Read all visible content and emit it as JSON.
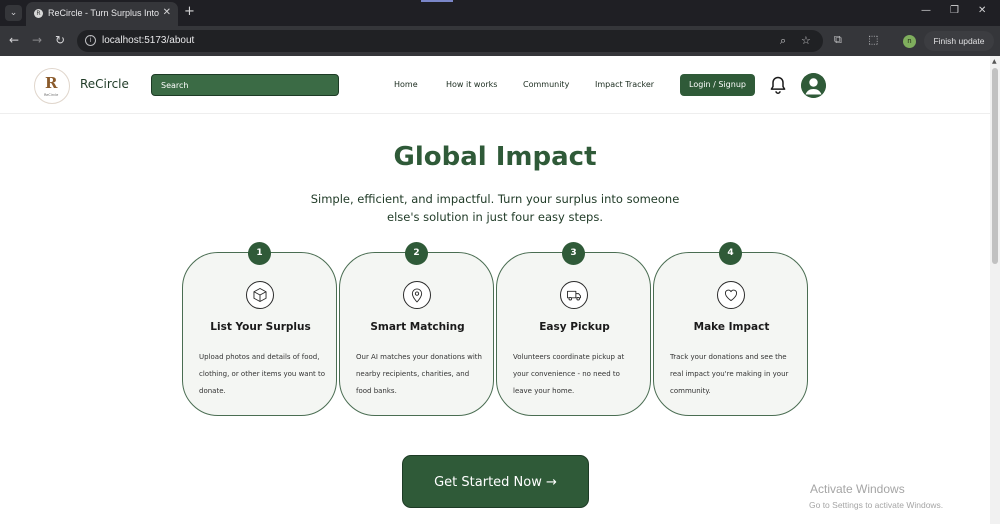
{
  "browser": {
    "tab_title": "ReCircle - Turn Surplus Into Su",
    "new_tab": "+",
    "url": "localhost:5173/about",
    "finish_update": "Finish update",
    "profile_initial": "n"
  },
  "header": {
    "brand": "ReCircle",
    "logo_sub": "ReCircle",
    "search_placeholder": "Search",
    "nav": [
      "Home",
      "How it works",
      "Community",
      "Impact Tracker"
    ],
    "login": "Login / Signup"
  },
  "hero": {
    "title": "Global Impact",
    "subtitle": "Simple, efficient, and impactful. Turn your surplus into someone else's solution in just four easy steps."
  },
  "steps": [
    {
      "number": "1",
      "icon": "box-icon",
      "title": "List Your Surplus",
      "description": "Upload photos and details of food, clothing, or other items you want to donate."
    },
    {
      "number": "2",
      "icon": "map-pin-icon",
      "title": "Smart Matching",
      "description": "Our AI matches your donations with nearby recipients, charities, and food banks."
    },
    {
      "number": "3",
      "icon": "truck-icon",
      "title": "Easy Pickup",
      "description": "Volunteers coordinate pickup at your convenience - no need to leave your home."
    },
    {
      "number": "4",
      "icon": "heart-icon",
      "title": "Make Impact",
      "description": "Track your donations and see the real impact you're making in your community."
    }
  ],
  "cta": {
    "label": "Get Started Now →"
  },
  "watermark": {
    "line1": "Activate Windows",
    "line2": "Go to Settings to activate Windows."
  },
  "colors": {
    "brand_green": "#2f5a38",
    "card_bg": "#f4f6f3",
    "chrome_dark": "#35363a"
  }
}
